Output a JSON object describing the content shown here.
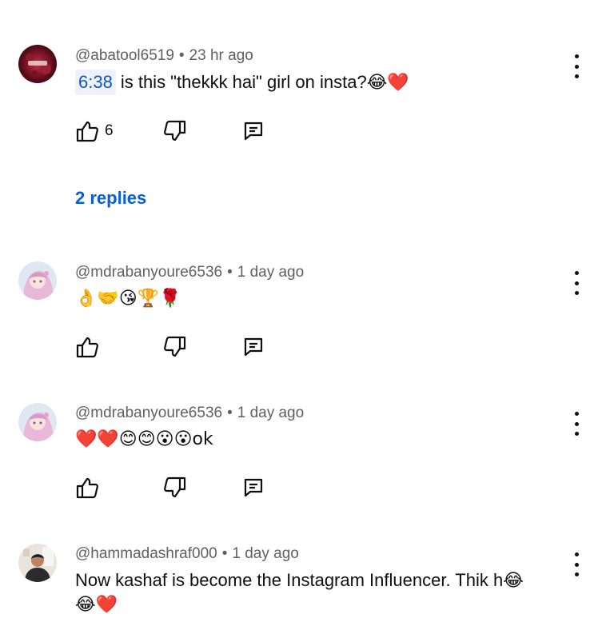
{
  "comments": [
    {
      "author": "@abatool6519",
      "time": "23 hr ago",
      "timestamp_link": "6:38",
      "text": "is this \"thekkk hai\" girl on insta?😂❤️",
      "likes": "6",
      "replies_label": "2 replies"
    },
    {
      "author": "@mdrabanyoure6536",
      "time": "1 day ago",
      "text": "👌🤝😘🏆🌹",
      "likes": ""
    },
    {
      "author": "@mdrabanyoure6536",
      "time": "1 day ago",
      "text": "❤️❤️😊😊😮😮ok",
      "likes": ""
    },
    {
      "author": "@hammadashraf000",
      "time": "1 day ago",
      "text": "Now kashaf is become the Instagram Influencer.  Thik h😂",
      "text_line2": "😂❤️"
    }
  ],
  "colors": {
    "meta": "#606060",
    "link": "#065fd4",
    "text": "#0f0f0f"
  },
  "icons": [
    "like-icon",
    "dislike-icon",
    "reply-icon",
    "more-vert-icon"
  ]
}
